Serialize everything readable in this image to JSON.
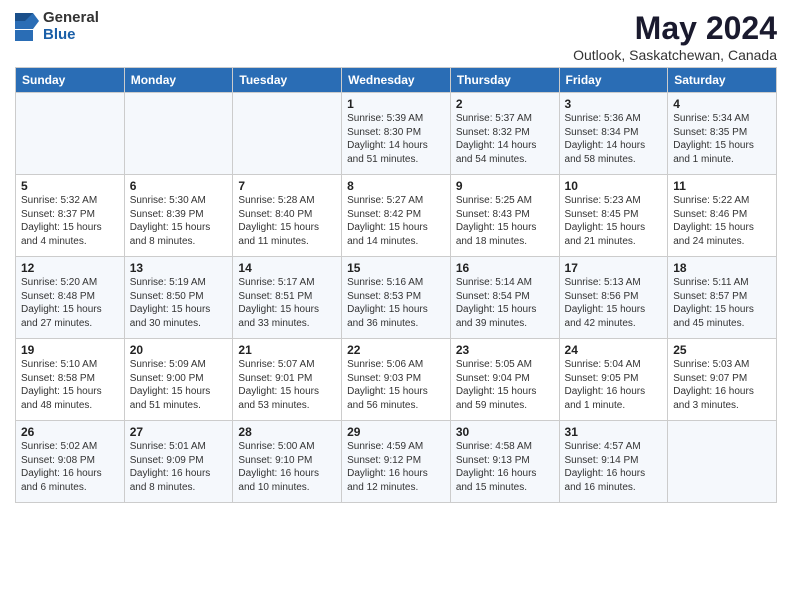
{
  "logo": {
    "general": "General",
    "blue": "Blue"
  },
  "header": {
    "title": "May 2024",
    "subtitle": "Outlook, Saskatchewan, Canada"
  },
  "weekdays": [
    "Sunday",
    "Monday",
    "Tuesday",
    "Wednesday",
    "Thursday",
    "Friday",
    "Saturday"
  ],
  "weeks": [
    [
      {
        "day": "",
        "info": ""
      },
      {
        "day": "",
        "info": ""
      },
      {
        "day": "",
        "info": ""
      },
      {
        "day": "1",
        "info": "Sunrise: 5:39 AM\nSunset: 8:30 PM\nDaylight: 14 hours\nand 51 minutes."
      },
      {
        "day": "2",
        "info": "Sunrise: 5:37 AM\nSunset: 8:32 PM\nDaylight: 14 hours\nand 54 minutes."
      },
      {
        "day": "3",
        "info": "Sunrise: 5:36 AM\nSunset: 8:34 PM\nDaylight: 14 hours\nand 58 minutes."
      },
      {
        "day": "4",
        "info": "Sunrise: 5:34 AM\nSunset: 8:35 PM\nDaylight: 15 hours\nand 1 minute."
      }
    ],
    [
      {
        "day": "5",
        "info": "Sunrise: 5:32 AM\nSunset: 8:37 PM\nDaylight: 15 hours\nand 4 minutes."
      },
      {
        "day": "6",
        "info": "Sunrise: 5:30 AM\nSunset: 8:39 PM\nDaylight: 15 hours\nand 8 minutes."
      },
      {
        "day": "7",
        "info": "Sunrise: 5:28 AM\nSunset: 8:40 PM\nDaylight: 15 hours\nand 11 minutes."
      },
      {
        "day": "8",
        "info": "Sunrise: 5:27 AM\nSunset: 8:42 PM\nDaylight: 15 hours\nand 14 minutes."
      },
      {
        "day": "9",
        "info": "Sunrise: 5:25 AM\nSunset: 8:43 PM\nDaylight: 15 hours\nand 18 minutes."
      },
      {
        "day": "10",
        "info": "Sunrise: 5:23 AM\nSunset: 8:45 PM\nDaylight: 15 hours\nand 21 minutes."
      },
      {
        "day": "11",
        "info": "Sunrise: 5:22 AM\nSunset: 8:46 PM\nDaylight: 15 hours\nand 24 minutes."
      }
    ],
    [
      {
        "day": "12",
        "info": "Sunrise: 5:20 AM\nSunset: 8:48 PM\nDaylight: 15 hours\nand 27 minutes."
      },
      {
        "day": "13",
        "info": "Sunrise: 5:19 AM\nSunset: 8:50 PM\nDaylight: 15 hours\nand 30 minutes."
      },
      {
        "day": "14",
        "info": "Sunrise: 5:17 AM\nSunset: 8:51 PM\nDaylight: 15 hours\nand 33 minutes."
      },
      {
        "day": "15",
        "info": "Sunrise: 5:16 AM\nSunset: 8:53 PM\nDaylight: 15 hours\nand 36 minutes."
      },
      {
        "day": "16",
        "info": "Sunrise: 5:14 AM\nSunset: 8:54 PM\nDaylight: 15 hours\nand 39 minutes."
      },
      {
        "day": "17",
        "info": "Sunrise: 5:13 AM\nSunset: 8:56 PM\nDaylight: 15 hours\nand 42 minutes."
      },
      {
        "day": "18",
        "info": "Sunrise: 5:11 AM\nSunset: 8:57 PM\nDaylight: 15 hours\nand 45 minutes."
      }
    ],
    [
      {
        "day": "19",
        "info": "Sunrise: 5:10 AM\nSunset: 8:58 PM\nDaylight: 15 hours\nand 48 minutes."
      },
      {
        "day": "20",
        "info": "Sunrise: 5:09 AM\nSunset: 9:00 PM\nDaylight: 15 hours\nand 51 minutes."
      },
      {
        "day": "21",
        "info": "Sunrise: 5:07 AM\nSunset: 9:01 PM\nDaylight: 15 hours\nand 53 minutes."
      },
      {
        "day": "22",
        "info": "Sunrise: 5:06 AM\nSunset: 9:03 PM\nDaylight: 15 hours\nand 56 minutes."
      },
      {
        "day": "23",
        "info": "Sunrise: 5:05 AM\nSunset: 9:04 PM\nDaylight: 15 hours\nand 59 minutes."
      },
      {
        "day": "24",
        "info": "Sunrise: 5:04 AM\nSunset: 9:05 PM\nDaylight: 16 hours\nand 1 minute."
      },
      {
        "day": "25",
        "info": "Sunrise: 5:03 AM\nSunset: 9:07 PM\nDaylight: 16 hours\nand 3 minutes."
      }
    ],
    [
      {
        "day": "26",
        "info": "Sunrise: 5:02 AM\nSunset: 9:08 PM\nDaylight: 16 hours\nand 6 minutes."
      },
      {
        "day": "27",
        "info": "Sunrise: 5:01 AM\nSunset: 9:09 PM\nDaylight: 16 hours\nand 8 minutes."
      },
      {
        "day": "28",
        "info": "Sunrise: 5:00 AM\nSunset: 9:10 PM\nDaylight: 16 hours\nand 10 minutes."
      },
      {
        "day": "29",
        "info": "Sunrise: 4:59 AM\nSunset: 9:12 PM\nDaylight: 16 hours\nand 12 minutes."
      },
      {
        "day": "30",
        "info": "Sunrise: 4:58 AM\nSunset: 9:13 PM\nDaylight: 16 hours\nand 15 minutes."
      },
      {
        "day": "31",
        "info": "Sunrise: 4:57 AM\nSunset: 9:14 PM\nDaylight: 16 hours\nand 16 minutes."
      },
      {
        "day": "",
        "info": ""
      }
    ]
  ]
}
